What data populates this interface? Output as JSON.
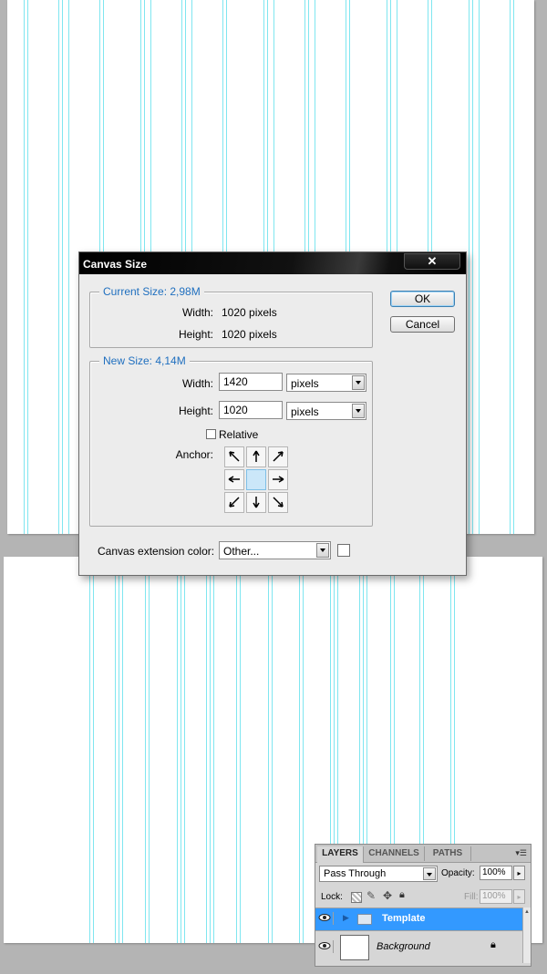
{
  "dialog": {
    "title": "Canvas Size",
    "ok_label": "OK",
    "cancel_label": "Cancel",
    "current_size": {
      "legend": "Current Size: 2,98M",
      "width_label": "Width:",
      "width_value": "1020 pixels",
      "height_label": "Height:",
      "height_value": "1020 pixels"
    },
    "new_size": {
      "legend": "New Size: 4,14M",
      "width_label": "Width:",
      "width_value": "1420",
      "width_unit": "pixels",
      "height_label": "Height:",
      "height_value": "1020",
      "height_unit": "pixels",
      "relative_label": "Relative",
      "relative_checked": false,
      "anchor_label": "Anchor:",
      "anchor_selected": "center"
    },
    "extension": {
      "label": "Canvas extension color:",
      "value": "Other...",
      "swatch_color": "#ffffff"
    }
  },
  "layers_panel": {
    "tabs": [
      "LAYERS",
      "CHANNELS",
      "PATHS"
    ],
    "active_tab": "LAYERS",
    "blend_mode": "Pass Through",
    "opacity_label": "Opacity:",
    "opacity_value": "100%",
    "lock_label": "Lock:",
    "fill_label": "Fill:",
    "fill_value": "100%",
    "layers": [
      {
        "name": "Template",
        "type": "group",
        "selected": true
      },
      {
        "name": "Background",
        "type": "layer",
        "locked": true
      }
    ]
  },
  "colors": {
    "guide": "#7fe6f0",
    "legend_text": "#1f6fbf",
    "selected_layer": "#3399ff"
  }
}
